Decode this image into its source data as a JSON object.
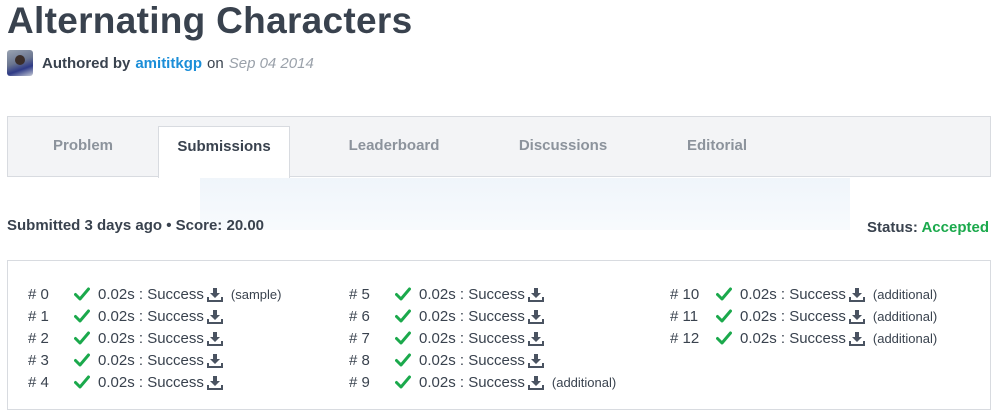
{
  "page": {
    "title": "Alternating Characters"
  },
  "author": {
    "prefix": "Authored by",
    "name": "amititkgp",
    "on": "on",
    "date": "Sep 04 2014"
  },
  "tabs": [
    {
      "label": "Problem",
      "active": false
    },
    {
      "label": "Submissions",
      "active": true
    },
    {
      "label": "Leaderboard",
      "active": false
    },
    {
      "label": "Discussions",
      "active": false
    },
    {
      "label": "Editorial",
      "active": false
    }
  ],
  "submission": {
    "summary": "Submitted 3 days ago • Score: 20.00",
    "status_label": "Status:",
    "status_value": "Accepted"
  },
  "colors": {
    "accent_link": "#1b8ed8",
    "success": "#1ba94c",
    "text": "#39424e",
    "muted": "#9aa1aa"
  },
  "icons": {
    "check": "check-icon",
    "download": "download-icon"
  },
  "testcases": [
    [
      {
        "num": "# 0",
        "result": "0.02s : Success",
        "note": "(sample)"
      },
      {
        "num": "# 1",
        "result": "0.02s : Success",
        "note": ""
      },
      {
        "num": "# 2",
        "result": "0.02s : Success",
        "note": ""
      },
      {
        "num": "# 3",
        "result": "0.02s : Success",
        "note": ""
      },
      {
        "num": "# 4",
        "result": "0.02s : Success",
        "note": ""
      }
    ],
    [
      {
        "num": "# 5",
        "result": "0.02s : Success",
        "note": ""
      },
      {
        "num": "# 6",
        "result": "0.02s : Success",
        "note": ""
      },
      {
        "num": "# 7",
        "result": "0.02s : Success",
        "note": ""
      },
      {
        "num": "# 8",
        "result": "0.02s : Success",
        "note": ""
      },
      {
        "num": "# 9",
        "result": "0.02s : Success",
        "note": "(additional)"
      }
    ],
    [
      {
        "num": "# 10",
        "result": "0.02s : Success",
        "note": "(additional)"
      },
      {
        "num": "# 11",
        "result": "0.02s : Success",
        "note": "(additional)"
      },
      {
        "num": "# 12",
        "result": "0.02s : Success",
        "note": "(additional)"
      }
    ]
  ]
}
